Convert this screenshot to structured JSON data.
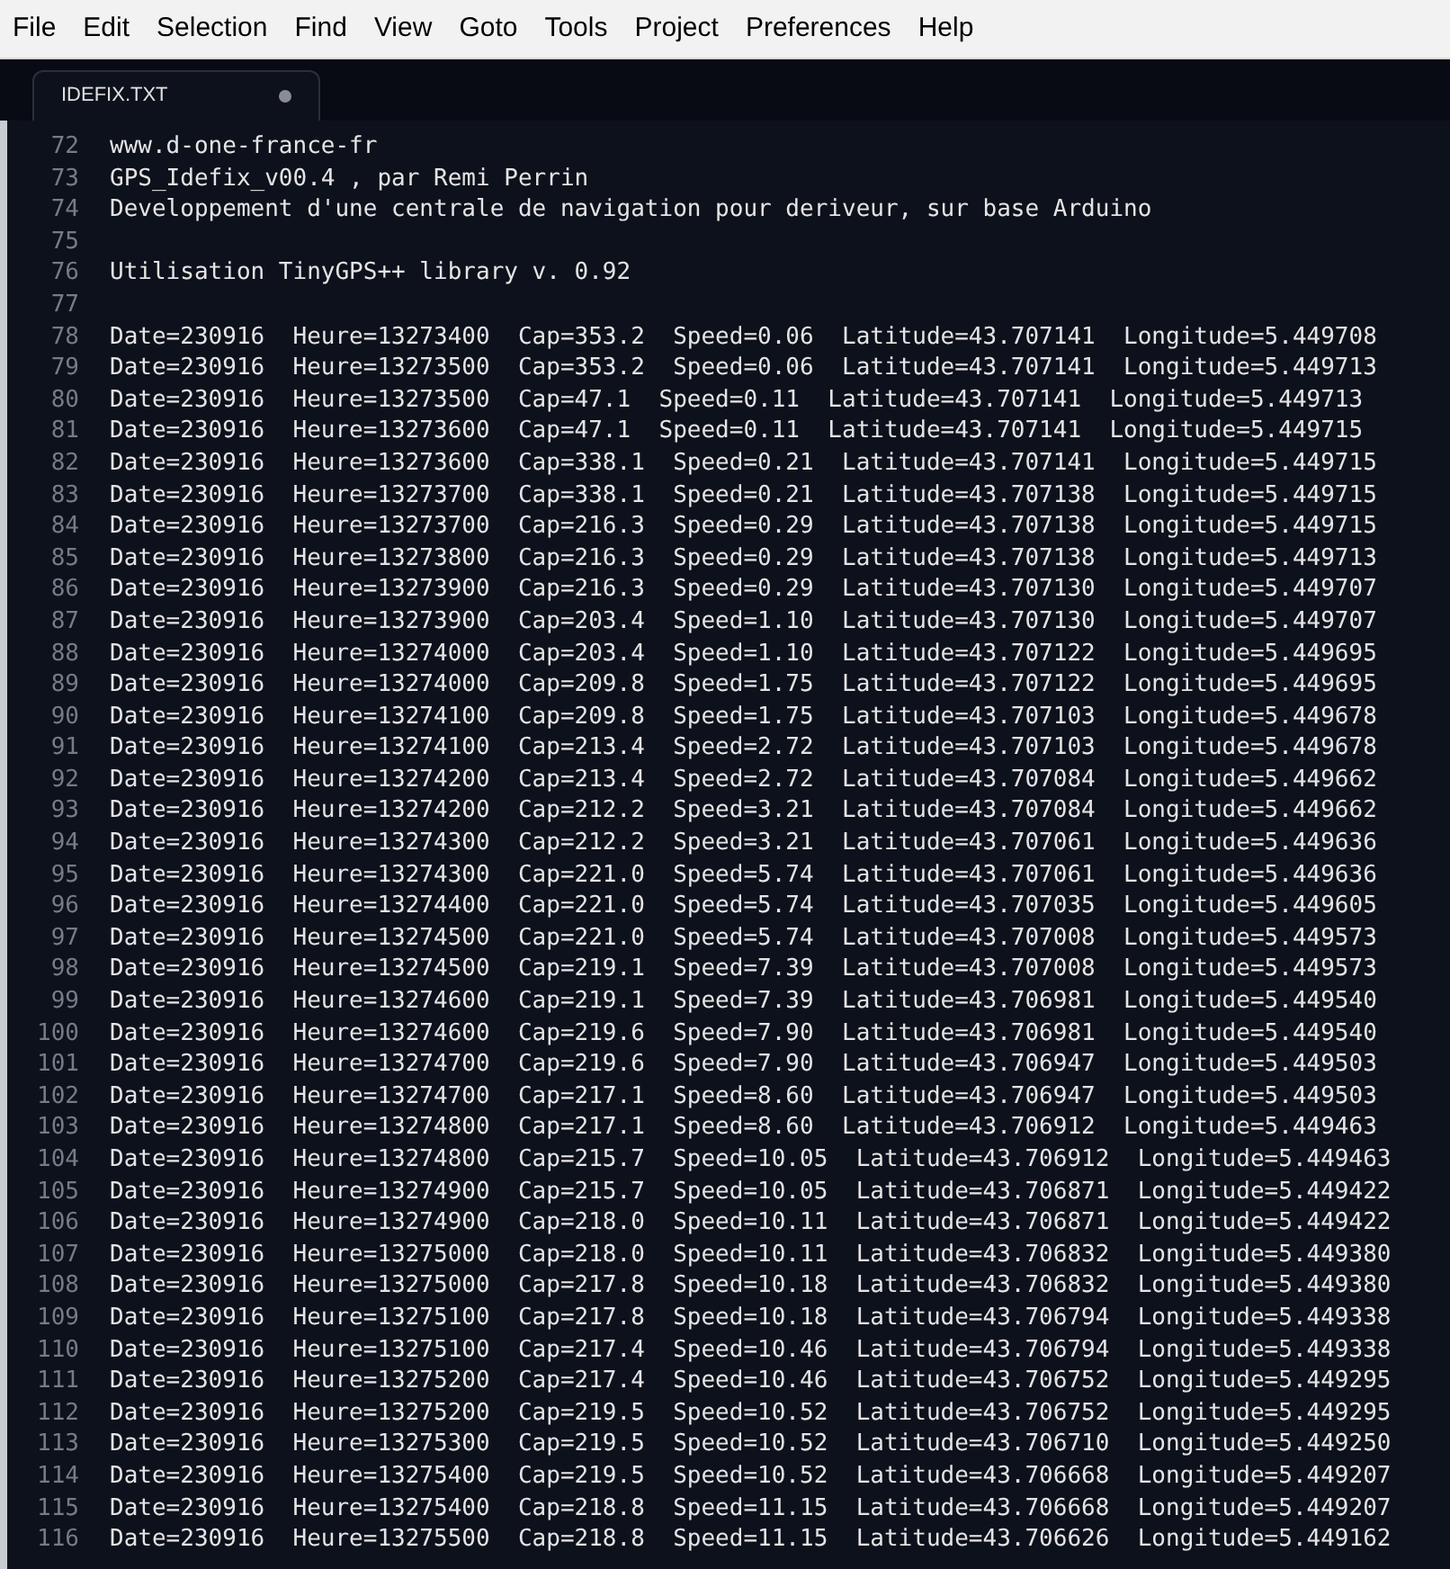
{
  "menu_bar": [
    "File",
    "Edit",
    "Selection",
    "Find",
    "View",
    "Goto",
    "Tools",
    "Project",
    "Preferences",
    "Help"
  ],
  "tabs": [
    {
      "label": "IDEFIX.TXT",
      "selected": true,
      "modified": true
    }
  ],
  "editor": {
    "lines": [
      {
        "number": "72",
        "text": "www.d-one-france-fr"
      },
      {
        "number": "73",
        "text": "GPS_Idefix_v00.4 , par Remi Perrin"
      },
      {
        "number": "74",
        "text": "Developpement d'une centrale de navigation pour deriveur, sur base Arduino"
      },
      {
        "number": "75"
      },
      {
        "number": "76",
        "text": "Utilisation TinyGPS++ library v. 0.92"
      },
      {
        "number": "77"
      },
      {
        "number": "78",
        "text": "Date=230916  Heure=13273400  Cap=353.2  Speed=0.06  Latitude=43.707141  Longitude=5.449708"
      },
      {
        "number": "79",
        "text": "Date=230916  Heure=13273500  Cap=353.2  Speed=0.06  Latitude=43.707141  Longitude=5.449713"
      },
      {
        "number": "80",
        "text": "Date=230916  Heure=13273500  Cap=47.1  Speed=0.11  Latitude=43.707141  Longitude=5.449713"
      },
      {
        "number": "81",
        "text": "Date=230916  Heure=13273600  Cap=47.1  Speed=0.11  Latitude=43.707141  Longitude=5.449715"
      },
      {
        "number": "82",
        "text": "Date=230916  Heure=13273600  Cap=338.1  Speed=0.21  Latitude=43.707141  Longitude=5.449715"
      },
      {
        "number": "83",
        "text": "Date=230916  Heure=13273700  Cap=338.1  Speed=0.21  Latitude=43.707138  Longitude=5.449715"
      },
      {
        "number": "84",
        "text": "Date=230916  Heure=13273700  Cap=216.3  Speed=0.29  Latitude=43.707138  Longitude=5.449715"
      },
      {
        "number": "85",
        "text": "Date=230916  Heure=13273800  Cap=216.3  Speed=0.29  Latitude=43.707138  Longitude=5.449713"
      },
      {
        "number": "86",
        "text": "Date=230916  Heure=13273900  Cap=216.3  Speed=0.29  Latitude=43.707130  Longitude=5.449707"
      },
      {
        "number": "87",
        "text": "Date=230916  Heure=13273900  Cap=203.4  Speed=1.10  Latitude=43.707130  Longitude=5.449707"
      },
      {
        "number": "88",
        "text": "Date=230916  Heure=13274000  Cap=203.4  Speed=1.10  Latitude=43.707122  Longitude=5.449695"
      },
      {
        "number": "89",
        "text": "Date=230916  Heure=13274000  Cap=209.8  Speed=1.75  Latitude=43.707122  Longitude=5.449695"
      },
      {
        "number": "90",
        "text": "Date=230916  Heure=13274100  Cap=209.8  Speed=1.75  Latitude=43.707103  Longitude=5.449678"
      },
      {
        "number": "91",
        "text": "Date=230916  Heure=13274100  Cap=213.4  Speed=2.72  Latitude=43.707103  Longitude=5.449678"
      },
      {
        "number": "92",
        "text": "Date=230916  Heure=13274200  Cap=213.4  Speed=2.72  Latitude=43.707084  Longitude=5.449662"
      },
      {
        "number": "93",
        "text": "Date=230916  Heure=13274200  Cap=212.2  Speed=3.21  Latitude=43.707084  Longitude=5.449662"
      },
      {
        "number": "94",
        "text": "Date=230916  Heure=13274300  Cap=212.2  Speed=3.21  Latitude=43.707061  Longitude=5.449636"
      },
      {
        "number": "95",
        "text": "Date=230916  Heure=13274300  Cap=221.0  Speed=5.74  Latitude=43.707061  Longitude=5.449636"
      },
      {
        "number": "96",
        "text": "Date=230916  Heure=13274400  Cap=221.0  Speed=5.74  Latitude=43.707035  Longitude=5.449605"
      },
      {
        "number": "97",
        "text": "Date=230916  Heure=13274500  Cap=221.0  Speed=5.74  Latitude=43.707008  Longitude=5.449573"
      },
      {
        "number": "98",
        "text": "Date=230916  Heure=13274500  Cap=219.1  Speed=7.39  Latitude=43.707008  Longitude=5.449573"
      },
      {
        "number": "99",
        "text": "Date=230916  Heure=13274600  Cap=219.1  Speed=7.39  Latitude=43.706981  Longitude=5.449540"
      },
      {
        "number": "100",
        "text": "Date=230916  Heure=13274600  Cap=219.6  Speed=7.90  Latitude=43.706981  Longitude=5.449540"
      },
      {
        "number": "101",
        "text": "Date=230916  Heure=13274700  Cap=219.6  Speed=7.90  Latitude=43.706947  Longitude=5.449503"
      },
      {
        "number": "102",
        "text": "Date=230916  Heure=13274700  Cap=217.1  Speed=8.60  Latitude=43.706947  Longitude=5.449503"
      },
      {
        "number": "103",
        "text": "Date=230916  Heure=13274800  Cap=217.1  Speed=8.60  Latitude=43.706912  Longitude=5.449463"
      },
      {
        "number": "104",
        "text": "Date=230916  Heure=13274800  Cap=215.7  Speed=10.05  Latitude=43.706912  Longitude=5.449463"
      },
      {
        "number": "105",
        "text": "Date=230916  Heure=13274900  Cap=215.7  Speed=10.05  Latitude=43.706871  Longitude=5.449422"
      },
      {
        "number": "106",
        "text": "Date=230916  Heure=13274900  Cap=218.0  Speed=10.11  Latitude=43.706871  Longitude=5.449422"
      },
      {
        "number": "107",
        "text": "Date=230916  Heure=13275000  Cap=218.0  Speed=10.11  Latitude=43.706832  Longitude=5.449380"
      },
      {
        "number": "108",
        "text": "Date=230916  Heure=13275000  Cap=217.8  Speed=10.18  Latitude=43.706832  Longitude=5.449380"
      },
      {
        "number": "109",
        "text": "Date=230916  Heure=13275100  Cap=217.8  Speed=10.18  Latitude=43.706794  Longitude=5.449338"
      },
      {
        "number": "110",
        "text": "Date=230916  Heure=13275100  Cap=217.4  Speed=10.46  Latitude=43.706794  Longitude=5.449338"
      },
      {
        "number": "111",
        "text": "Date=230916  Heure=13275200  Cap=217.4  Speed=10.46  Latitude=43.706752  Longitude=5.449295"
      },
      {
        "number": "112",
        "text": "Date=230916  Heure=13275200  Cap=219.5  Speed=10.52  Latitude=43.706752  Longitude=5.449295"
      },
      {
        "number": "113",
        "text": "Date=230916  Heure=13275300  Cap=219.5  Speed=10.52  Latitude=43.706710  Longitude=5.449250"
      },
      {
        "number": "114",
        "text": "Date=230916  Heure=13275400  Cap=219.5  Speed=10.52  Latitude=43.706668  Longitude=5.449207"
      },
      {
        "number": "115",
        "text": "Date=230916  Heure=13275400  Cap=218.8  Speed=11.15  Latitude=43.706668  Longitude=5.449207"
      },
      {
        "number": "116",
        "text": "Date=230916  Heure=13275500  Cap=218.8  Speed=11.15  Latitude=43.706626  Longitude=5.449162"
      }
    ]
  }
}
